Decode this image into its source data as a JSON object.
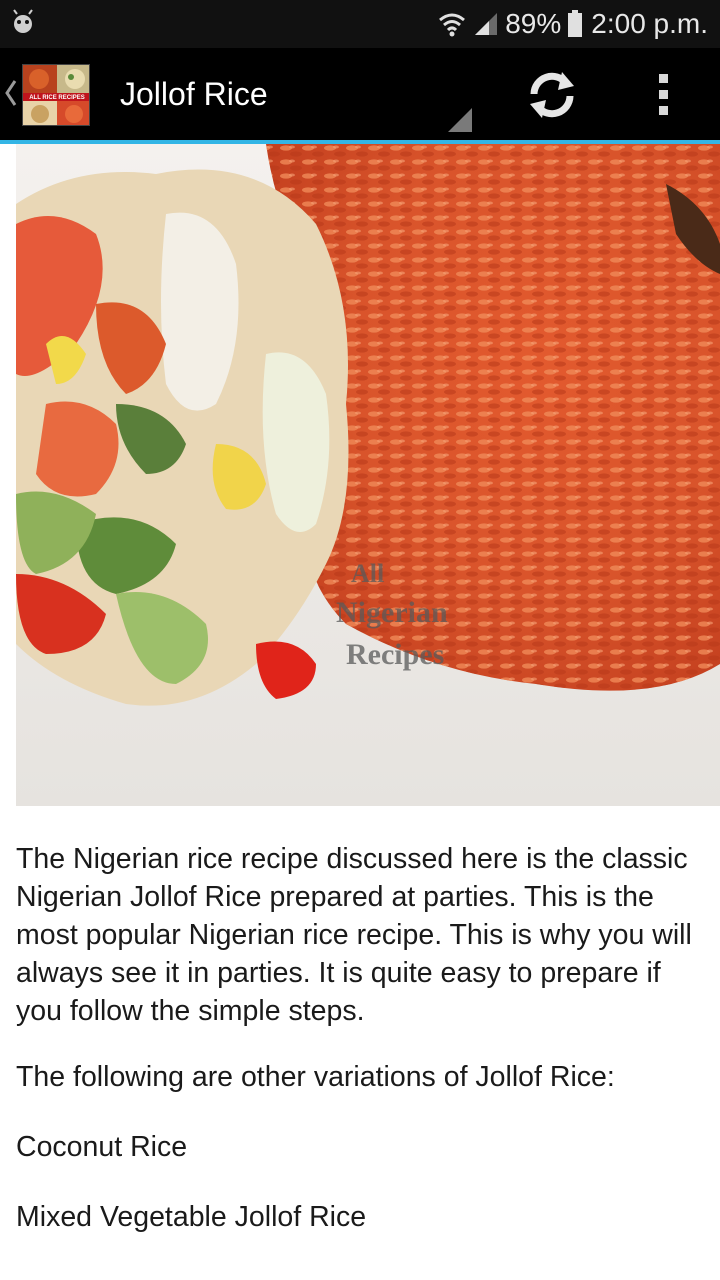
{
  "status_bar": {
    "battery": "89%",
    "time": "2:00 p.m."
  },
  "action_bar": {
    "title": "Jollof Rice",
    "logo_text": "ALL RICE RECIPES",
    "accent_color": "#33b5e5"
  },
  "hero_image": {
    "watermark_lines": [
      "All",
      "Nigerian",
      "Recipes"
    ]
  },
  "content": {
    "paragraphs": [
      "The Nigerian rice recipe discussed here is the classic Nigerian Jollof Rice prepared at parties. This is the most popular Nigerian rice recipe. This is why you will always see it in parties. It is quite easy to prepare if you follow the simple steps.",
      "The following are other variations of Jollof Rice:",
      "Coconut Rice",
      "Mixed Vegetable Jollof Rice"
    ]
  },
  "icons": {
    "status_left": "android-debug-icon",
    "wifi": "wifi-icon",
    "signal": "signal-icon",
    "battery": "battery-icon",
    "back": "up-caret-icon",
    "refresh": "refresh-icon",
    "overflow": "overflow-menu-icon"
  }
}
